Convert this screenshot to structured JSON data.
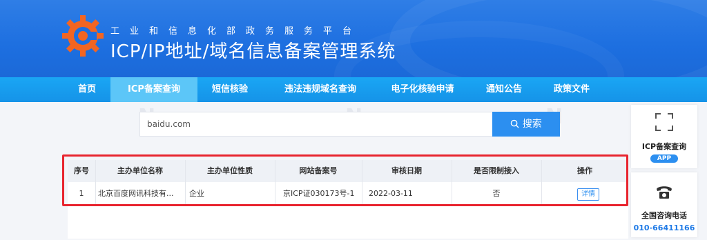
{
  "header": {
    "subtitle": "工业和信息化部政务服务平台",
    "title": "ICP/IP地址/域名信息备案管理系统"
  },
  "nav": {
    "items": [
      {
        "label": "首页"
      },
      {
        "label": "ICP备案查询",
        "active": true
      },
      {
        "label": "短信核验"
      },
      {
        "label": "违法违规域名查询"
      },
      {
        "label": "电子化核验申请"
      },
      {
        "label": "通知公告"
      },
      {
        "label": "政策文件"
      }
    ]
  },
  "search": {
    "value": "baidu.com",
    "button_label": "搜索"
  },
  "table": {
    "headers": [
      "序号",
      "主办单位名称",
      "主办单位性质",
      "网站备案号",
      "审核日期",
      "是否限制接入",
      "操作"
    ],
    "rows": [
      {
        "index": "1",
        "name": "北京百度网讯科技有...",
        "nature": "企业",
        "record_no": "京ICP证030173号-1",
        "date": "2022-03-11",
        "restricted": "否",
        "action": "详情"
      }
    ]
  },
  "side": {
    "app_label": "ICP备案查询",
    "app_badge": "APP",
    "hotline_label": "全国咨询电话",
    "hotline_number": "010-66411166"
  },
  "colors": {
    "header_blue": "#1d6fe0",
    "nav_blue": "#1593e8",
    "accent": "#2c8ff0",
    "highlight_frame": "#e8242e"
  }
}
